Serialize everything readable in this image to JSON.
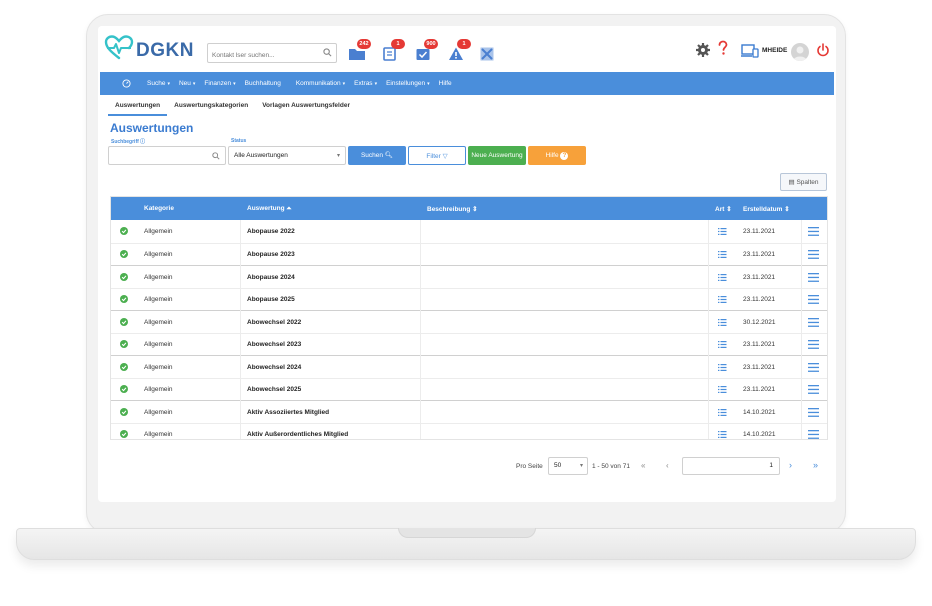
{
  "header": {
    "logo_text": "DGKN",
    "search_placeholder": "Kontakt lser suchen...",
    "badges": [
      "242",
      "1",
      "900",
      "1"
    ],
    "user_name": "MHEIDE"
  },
  "nav": {
    "items": [
      {
        "label": "Suche",
        "caret": true
      },
      {
        "label": "Neu",
        "caret": true
      },
      {
        "label": "Finanzen",
        "caret": true
      },
      {
        "label": "Buchhaltung",
        "caret": false
      },
      {
        "label": "Kommunikation",
        "caret": true
      },
      {
        "label": "Extras",
        "caret": true
      },
      {
        "label": "Einstellungen",
        "caret": true
      },
      {
        "label": "Hilfe",
        "caret": false
      }
    ],
    "caret_glyph": "▾"
  },
  "subtabs": [
    "Auswertungen",
    "Auswertungskategorien",
    "Vorlagen Auswertungsfelder"
  ],
  "page_title": "Auswertungen",
  "filters": {
    "suchbegriff_label": "Suchbegriff",
    "status_label": "Status",
    "status_value": "Alle Auswertungen",
    "btn_search": "Suchen",
    "btn_filter": "Filter",
    "btn_new": "Neue Auswertung",
    "btn_help": "Hilfe",
    "btn_columns": "Spalten"
  },
  "table": {
    "headers": {
      "kategorie": "Kategorie",
      "auswertung": "Auswertung",
      "beschreibung": "Beschreibung",
      "art": "Art",
      "erstelldatum": "Erstelldatum"
    },
    "rows": [
      {
        "kategorie": "Allgemein",
        "auswertung": "Abopause 2022",
        "datum": "23.11.2021"
      },
      {
        "kategorie": "Allgemein",
        "auswertung": "Abopause 2023",
        "datum": "23.11.2021"
      },
      {
        "kategorie": "Allgemein",
        "auswertung": "Abopause 2024",
        "datum": "23.11.2021"
      },
      {
        "kategorie": "Allgemein",
        "auswertung": "Abopause 2025",
        "datum": "23.11.2021"
      },
      {
        "kategorie": "Allgemein",
        "auswertung": "Abowechsel 2022",
        "datum": "30.12.2021"
      },
      {
        "kategorie": "Allgemein",
        "auswertung": "Abowechsel 2023",
        "datum": "23.11.2021"
      },
      {
        "kategorie": "Allgemein",
        "auswertung": "Abowechsel 2024",
        "datum": "23.11.2021"
      },
      {
        "kategorie": "Allgemein",
        "auswertung": "Abowechsel 2025",
        "datum": "23.11.2021"
      },
      {
        "kategorie": "Allgemein",
        "auswertung": "Aktiv Assoziiertes Mitglied",
        "datum": "14.10.2021"
      },
      {
        "kategorie": "Allgemein",
        "auswertung": "Aktiv Außerordentliches Mitglied",
        "datum": "14.10.2021"
      }
    ]
  },
  "pager": {
    "per_page_label": "Pro Seite",
    "per_page_value": "50",
    "range": "1 - 50 von 71",
    "page": "1"
  },
  "colors": {
    "primary": "#4a8edb",
    "success": "#4caf50",
    "warning": "#f7a13a",
    "badge": "#e53935"
  }
}
